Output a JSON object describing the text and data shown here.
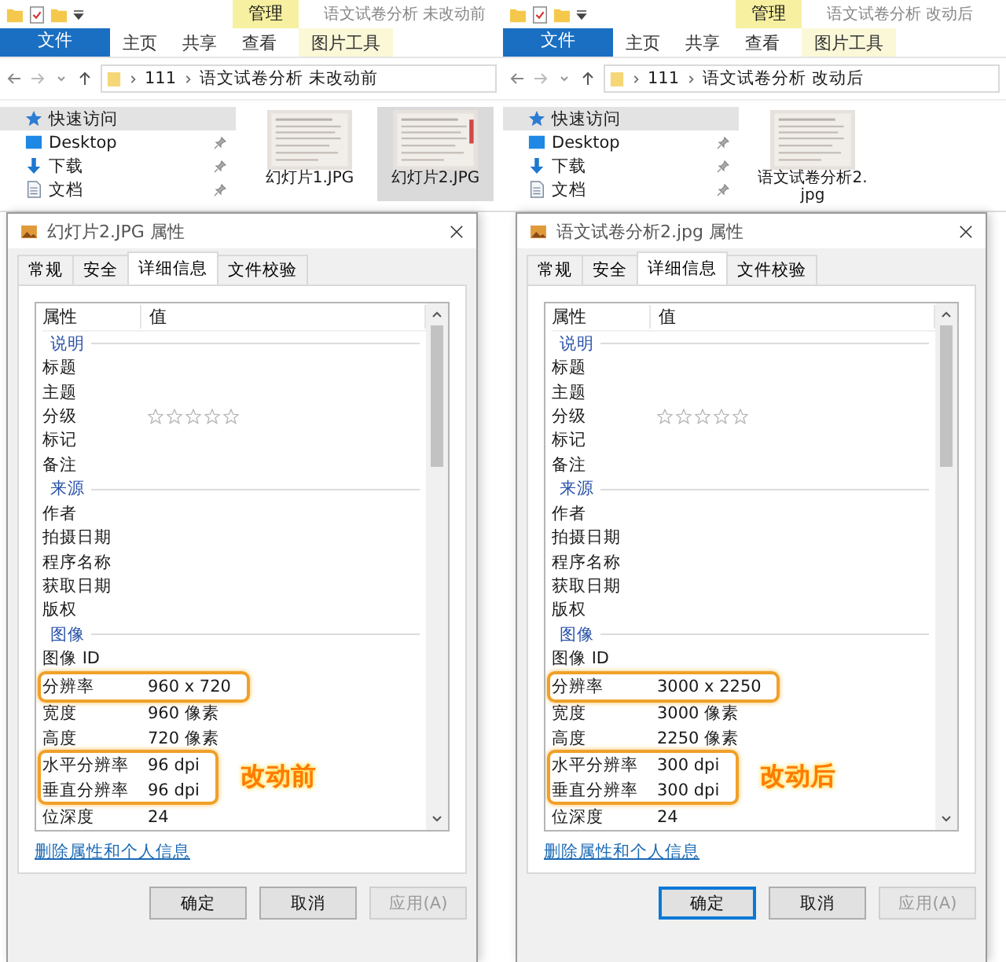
{
  "panes": [
    {
      "explorer": {
        "context_tab": "管理",
        "title": "语文试卷分析 未改动前",
        "ribbon_tabs": [
          {
            "label": "文件",
            "kind": "file"
          },
          {
            "label": "主页",
            "kind": "tab"
          },
          {
            "label": "共享",
            "kind": "tab"
          },
          {
            "label": "查看",
            "kind": "tab"
          },
          {
            "label": "图片工具",
            "kind": "context"
          }
        ],
        "path": [
          "111",
          "语文试卷分析 未改动前"
        ],
        "nav": [
          {
            "label": "快速访问",
            "pinned": false,
            "selected": true
          },
          {
            "label": "Desktop",
            "pinned": true,
            "selected": false
          },
          {
            "label": "下载",
            "pinned": true,
            "selected": false
          },
          {
            "label": "文档",
            "pinned": true,
            "selected": false
          }
        ],
        "files": [
          {
            "label": "幻灯片1.JPG",
            "selected": false
          },
          {
            "label": "幻灯片2.JPG",
            "selected": true
          }
        ]
      },
      "dialog": {
        "title": "幻灯片2.JPG 属性",
        "tabs": [
          {
            "label": "常规",
            "selected": false
          },
          {
            "label": "安全",
            "selected": false
          },
          {
            "label": "详细信息",
            "selected": true
          },
          {
            "label": "文件校验",
            "selected": false
          }
        ],
        "columns": [
          "属性",
          "值"
        ],
        "properties": [
          {
            "kind": "section",
            "label": "说明"
          },
          {
            "kind": "property",
            "name": "标题",
            "highlighted": false
          },
          {
            "kind": "property",
            "name": "主题",
            "highlighted": false
          },
          {
            "kind": "rating",
            "name": "分级",
            "stars": 0,
            "highlighted": false
          },
          {
            "kind": "property",
            "name": "标记",
            "highlighted": false
          },
          {
            "kind": "property",
            "name": "备注",
            "highlighted": false
          },
          {
            "kind": "section",
            "label": "来源"
          },
          {
            "kind": "property",
            "name": "作者",
            "highlighted": false
          },
          {
            "kind": "property",
            "name": "拍摄日期",
            "highlighted": false
          },
          {
            "kind": "property",
            "name": "程序名称",
            "highlighted": false
          },
          {
            "kind": "property",
            "name": "获取日期",
            "highlighted": false
          },
          {
            "kind": "property",
            "name": "版权",
            "highlighted": false
          },
          {
            "kind": "section",
            "label": "图像"
          },
          {
            "kind": "property",
            "name": "图像 ID",
            "highlighted": false
          },
          {
            "kind": "property",
            "name": "分辨率",
            "value": "960 x 720",
            "highlighted": true
          },
          {
            "kind": "property",
            "name": "宽度",
            "value": "960 像素",
            "highlighted": false
          },
          {
            "kind": "property",
            "name": "高度",
            "value": "720 像素",
            "highlighted": false
          },
          {
            "kind": "property",
            "name": "水平分辨率",
            "value": "96 dpi",
            "highlighted": true
          },
          {
            "kind": "property",
            "name": "垂直分辨率",
            "value": "96 dpi",
            "highlighted": true
          },
          {
            "kind": "property",
            "name": "位深度",
            "value": "24",
            "highlighted": false
          }
        ],
        "annotation": "改动前",
        "link": "删除属性和个人信息",
        "buttons": [
          {
            "label": "确定",
            "focused": false,
            "disabled": false
          },
          {
            "label": "取消",
            "focused": false,
            "disabled": false
          },
          {
            "label": "应用(A)",
            "focused": false,
            "disabled": true
          }
        ]
      }
    },
    {
      "explorer": {
        "context_tab": "管理",
        "title": "语文试卷分析 改动后",
        "ribbon_tabs": [
          {
            "label": "文件",
            "kind": "file"
          },
          {
            "label": "主页",
            "kind": "tab"
          },
          {
            "label": "共享",
            "kind": "tab"
          },
          {
            "label": "查看",
            "kind": "tab"
          },
          {
            "label": "图片工具",
            "kind": "context"
          }
        ],
        "path": [
          "111",
          "语文试卷分析 改动后"
        ],
        "nav": [
          {
            "label": "快速访问",
            "pinned": false,
            "selected": true
          },
          {
            "label": "Desktop",
            "pinned": true,
            "selected": false
          },
          {
            "label": "下载",
            "pinned": true,
            "selected": false
          },
          {
            "label": "文档",
            "pinned": true,
            "selected": false
          }
        ],
        "files": [
          {
            "label": "语文试卷分析2.jpg",
            "selected": false
          }
        ]
      },
      "dialog": {
        "title": "语文试卷分析2.jpg 属性",
        "tabs": [
          {
            "label": "常规",
            "selected": false
          },
          {
            "label": "安全",
            "selected": false
          },
          {
            "label": "详细信息",
            "selected": true
          },
          {
            "label": "文件校验",
            "selected": false
          }
        ],
        "columns": [
          "属性",
          "值"
        ],
        "properties": [
          {
            "kind": "section",
            "label": "说明"
          },
          {
            "kind": "property",
            "name": "标题",
            "highlighted": false
          },
          {
            "kind": "property",
            "name": "主题",
            "highlighted": false
          },
          {
            "kind": "rating",
            "name": "分级",
            "stars": 0,
            "highlighted": false
          },
          {
            "kind": "property",
            "name": "标记",
            "highlighted": false
          },
          {
            "kind": "property",
            "name": "备注",
            "highlighted": false
          },
          {
            "kind": "section",
            "label": "来源"
          },
          {
            "kind": "property",
            "name": "作者",
            "highlighted": false
          },
          {
            "kind": "property",
            "name": "拍摄日期",
            "highlighted": false
          },
          {
            "kind": "property",
            "name": "程序名称",
            "highlighted": false
          },
          {
            "kind": "property",
            "name": "获取日期",
            "highlighted": false
          },
          {
            "kind": "property",
            "name": "版权",
            "highlighted": false
          },
          {
            "kind": "section",
            "label": "图像"
          },
          {
            "kind": "property",
            "name": "图像 ID",
            "highlighted": false
          },
          {
            "kind": "property",
            "name": "分辨率",
            "value": "3000 x 2250",
            "highlighted": true
          },
          {
            "kind": "property",
            "name": "宽度",
            "value": "3000 像素",
            "highlighted": false
          },
          {
            "kind": "property",
            "name": "高度",
            "value": "2250 像素",
            "highlighted": false
          },
          {
            "kind": "property",
            "name": "水平分辨率",
            "value": "300 dpi",
            "highlighted": true
          },
          {
            "kind": "property",
            "name": "垂直分辨率",
            "value": "300 dpi",
            "highlighted": true
          },
          {
            "kind": "property",
            "name": "位深度",
            "value": "24",
            "highlighted": false
          }
        ],
        "annotation": "改动后",
        "link": "删除属性和个人信息",
        "buttons": [
          {
            "label": "确定",
            "focused": true,
            "disabled": false
          },
          {
            "label": "取消",
            "focused": false,
            "disabled": false
          },
          {
            "label": "应用(A)",
            "focused": false,
            "disabled": true
          }
        ]
      }
    }
  ]
}
